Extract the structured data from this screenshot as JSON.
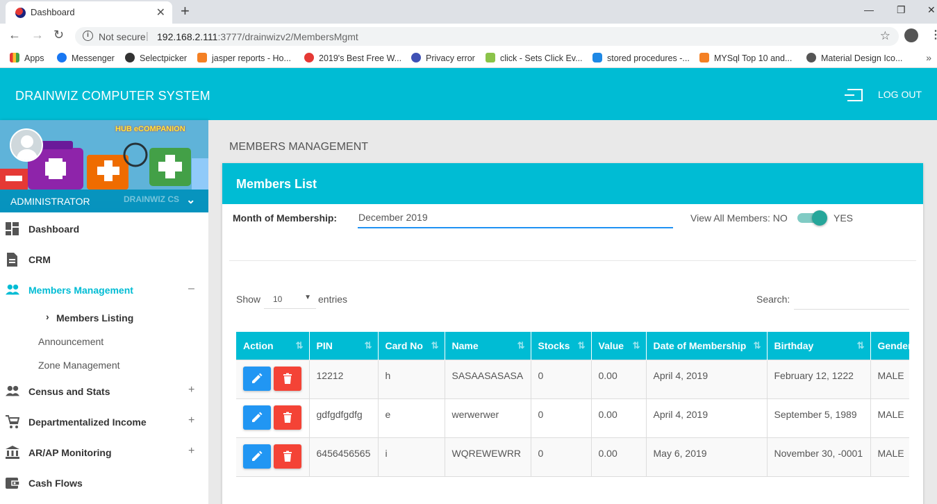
{
  "browser": {
    "tab_title": "Dashboard",
    "new_tab": "+",
    "not_secure": "Not secure",
    "url_separator": "|",
    "url_host": "192.168.2.111",
    "url_path": ":3777/drainwizv2/MembersMgmt",
    "bookmarks": [
      {
        "label": "Apps",
        "color": "#e53935"
      },
      {
        "label": "Messenger",
        "color": "#1877f2"
      },
      {
        "label": "Selectpicker",
        "color": "#333333"
      },
      {
        "label": "jasper reports - Ho...",
        "color": "#f48024"
      },
      {
        "label": "2019's Best Free W...",
        "color": "#e53935"
      },
      {
        "label": "Privacy error",
        "color": "#3f51b5"
      },
      {
        "label": "click - Sets Click Ev...",
        "color": "#8bc34a"
      },
      {
        "label": "stored procedures -...",
        "color": "#1e88e5"
      },
      {
        "label": "MYSql Top 10 and...",
        "color": "#f48024"
      },
      {
        "label": "Material Design Ico...",
        "color": "#555555"
      }
    ],
    "bookmarks_more": "»"
  },
  "header": {
    "app_title": "DRAINWIZ COMPUTER SYSTEM",
    "logout_label": "LOG OUT"
  },
  "sidebar": {
    "banner_text": "HUB eCOMPANION",
    "user_name": "ADMINISTRATOR",
    "watermark": "DRAINWIZ CS",
    "items": [
      {
        "label": "Dashboard",
        "icon": "dashboard-icon",
        "toggle": ""
      },
      {
        "label": "CRM",
        "icon": "document-icon",
        "toggle": ""
      },
      {
        "label": "Members Management",
        "icon": "people-icon",
        "toggle": "–"
      },
      {
        "label": "Census and Stats",
        "icon": "people-icon",
        "toggle": "+"
      },
      {
        "label": "Departmentalized Income",
        "icon": "cart-icon",
        "toggle": "+"
      },
      {
        "label": "AR/AP Monitoring",
        "icon": "bank-icon",
        "toggle": "+"
      },
      {
        "label": "Cash Flows",
        "icon": "wallet-icon",
        "toggle": ""
      }
    ],
    "sub_items": [
      {
        "label": "Members Listing"
      },
      {
        "label": "Announcement"
      },
      {
        "label": "Zone Management"
      }
    ]
  },
  "main": {
    "page_title": "MEMBERS MANAGEMENT",
    "card_title": "Members List",
    "month_label": "Month of Membership:",
    "month_value": "December 2019",
    "view_all_label": "View All Members: NO",
    "view_all_on": true,
    "yes_label": "YES",
    "show_label": "Show",
    "entries_value": "10",
    "entries_label": "entries",
    "search_label": "Search:",
    "search_value": ""
  },
  "table": {
    "columns": [
      "Action",
      "PIN",
      "Card No",
      "Name",
      "Stocks",
      "Value",
      "Date of Membership",
      "Birthday",
      "Gender"
    ],
    "rows": [
      [
        "12212",
        "h",
        "SASAASASASA",
        "0",
        "0.00",
        "April 4, 2019",
        "February 12, 1222",
        "MALE"
      ],
      [
        "gdfgdfgdfg",
        "e",
        "werwerwer",
        "0",
        "0.00",
        "April 4, 2019",
        "September 5, 1989",
        "MALE"
      ],
      [
        "6456456565",
        "i",
        "WQREWEWRR",
        "0",
        "0.00",
        "May 6, 2019",
        "November 30, -0001",
        "MALE"
      ]
    ]
  },
  "colors": {
    "accent": "#00bcd4",
    "edit": "#2196f3",
    "delete": "#f44336",
    "switch": "#26a69a"
  }
}
